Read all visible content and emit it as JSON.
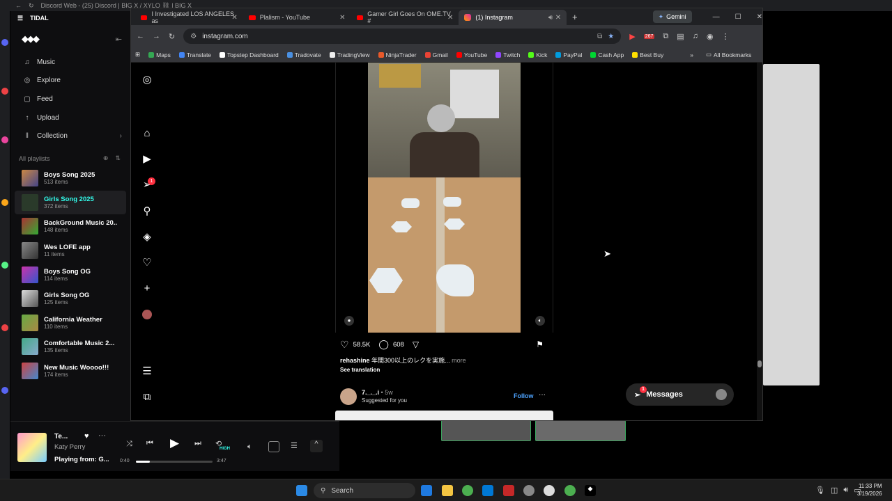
{
  "discord": {
    "title": "Discord Web - (25) Discord | BIG X / XYLO ⛓ | BIG X"
  },
  "tidal": {
    "app_name": "TIDAL",
    "nav": [
      {
        "label": "Music",
        "icon": "music-note-icon"
      },
      {
        "label": "Explore",
        "icon": "globe-icon"
      },
      {
        "label": "Feed",
        "icon": "feed-icon"
      },
      {
        "label": "Upload",
        "icon": "upload-icon"
      },
      {
        "label": "Collection",
        "icon": "collection-icon"
      }
    ],
    "playlists_header": "All playlists",
    "playlists": [
      {
        "name": "Boys Song 2025",
        "count": "513 items"
      },
      {
        "name": "Girls Song 2025",
        "count": "372 items"
      },
      {
        "name": "BackGround Music 20...",
        "count": "148 items"
      },
      {
        "name": "Wes LOFE app",
        "count": "11 items"
      },
      {
        "name": "Boys Song OG",
        "count": "114 items"
      },
      {
        "name": "Girls Song OG",
        "count": "125 items"
      },
      {
        "name": "California Weather",
        "count": "110 items"
      },
      {
        "name": "Comfortable Music 2...",
        "count": "135 items"
      },
      {
        "name": "New Music Woooo!!!",
        "count": "174 items"
      }
    ],
    "player": {
      "track": "Te...",
      "artist": "Katy Perry",
      "playing_from": "Playing from: G...",
      "elapsed": "0:40",
      "duration": "3:47",
      "progress": 0.18,
      "quality": "HIGH"
    }
  },
  "chrome": {
    "tabs": [
      {
        "title": "I Investigated LOS ANGELES as"
      },
      {
        "title": "Plalism - YouTube"
      },
      {
        "title": "Gamer Girl Goes On OME.TV #"
      },
      {
        "title": "(1) Instagram"
      }
    ],
    "gemini_label": "Gemini",
    "url": "instagram.com",
    "ext_badge": "267",
    "bookmarks": [
      "Maps",
      "Translate",
      "Topstep Dashboard",
      "Tradovate",
      "TradingView",
      "NinjaTrader",
      "Gmail",
      "YouTube",
      "Twitch",
      "Kick",
      "PayPal",
      "Cash App",
      "Best Buy"
    ],
    "all_bookmarks": "All Bookmarks"
  },
  "instagram": {
    "notif_count": "1",
    "likes": "58.5K",
    "comments": "608",
    "caption_user": "rehashine",
    "caption_text": "年間300以上のレクを実施...",
    "more": "more",
    "see_translation": "See translation",
    "next_user": "7._._.i",
    "next_time": "• 5w",
    "suggested": "Suggested for you",
    "follow": "Follow",
    "messages": "Messages",
    "messages_badge": "1"
  },
  "taskbar": {
    "search": "Search",
    "time": "11:33 PM",
    "date": "3/19/2026"
  }
}
